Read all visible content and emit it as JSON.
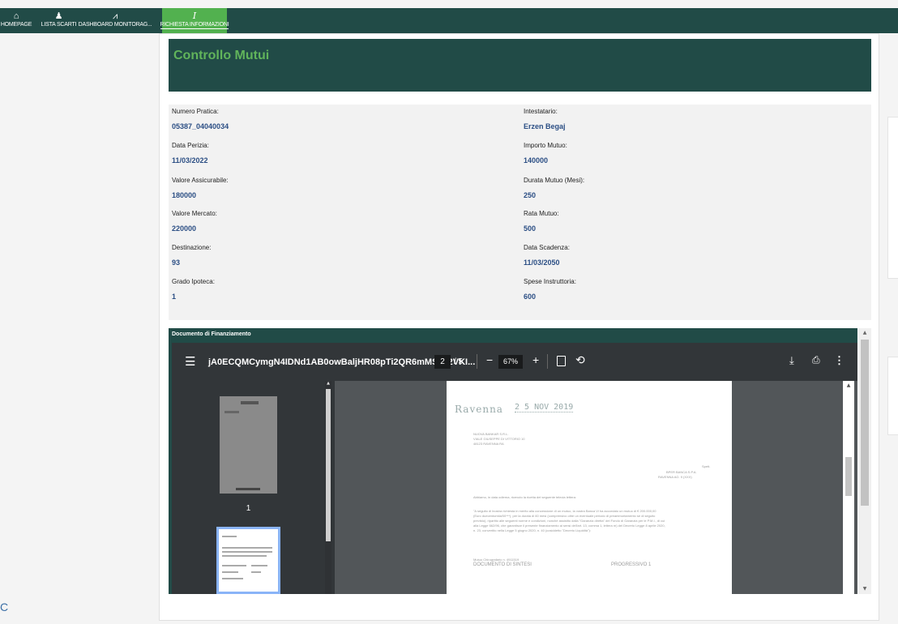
{
  "nav": {
    "items": [
      {
        "label": "HOMEPAGE",
        "icon": "home-icon",
        "glyph": "⌂"
      },
      {
        "label": "LISTA SCARTI",
        "icon": "user-icon",
        "glyph": "♟"
      },
      {
        "label": "DASHBOARD MONITORAG...",
        "icon": "chart-icon",
        "glyph": "⩘"
      },
      {
        "label": "RICHIESTA INFORMAZIONI",
        "icon": "text-cursor-icon",
        "glyph": "I",
        "active": true
      }
    ]
  },
  "page": {
    "title": "Controllo Mutui"
  },
  "fields": {
    "numero_pratica": {
      "label": "Numero Pratica:",
      "value": "05387_04040034"
    },
    "data_perizia": {
      "label": "Data Perizia:",
      "value": "11/03/2022"
    },
    "valore_assicurabile": {
      "label": "Valore Assicurabile:",
      "value": "180000"
    },
    "valore_mercato": {
      "label": "Valore Mercato:",
      "value": "220000"
    },
    "destinazione": {
      "label": "Destinazione:",
      "value": "93"
    },
    "grado_ipoteca": {
      "label": "Grado Ipoteca:",
      "value": "1"
    },
    "intestatario": {
      "label": "Intestatario:",
      "value": "Erzen Begaj"
    },
    "importo_mutuo": {
      "label": "Importo Mutuo:",
      "value": "140000"
    },
    "durata_mutuo": {
      "label": "Durata Mutuo (Mesi):",
      "value": "250"
    },
    "rata_mutuo": {
      "label": "Rata Mutuo:",
      "value": "500"
    },
    "data_scadenza": {
      "label": "Data Scadenza:",
      "value": "11/03/2050"
    },
    "spese_istruttoria": {
      "label": "Spese Instruttoria:",
      "value": "600"
    }
  },
  "document": {
    "section_title": "Documento di Finanziamento",
    "viewer": {
      "file_name": "jA0ECQMCymgN4IDNd1AB0owBaljHR08pTi2QR6mMS2J2VKI...",
      "current_page": "2",
      "total_pages": "/ 5",
      "zoom": "67%",
      "thumbnail_label": "1",
      "page_text": {
        "stamp": "Ravenna",
        "stamp_date": "2 5 NOV 2019",
        "addr1": "NUOVA BANKAR S.R.L.",
        "addr2": "VIALE GIUSEPPE DI VITTORIO 10",
        "addr3": "48123 RAVENNA RA",
        "recv1": "Spett.",
        "recv2": "BPER BANCA S.P.A.",
        "recv3": "RAVENNA AG. 9 (XXX)",
        "intro": "Abbiamo, in data odierna, ricevuto la ricetta del seguente telecia lettera:",
        "body1": "\"A seguito di lnostra richiesta in merito alla concessione di un mutuo, la vostra Banca Vi ha accordato un mutuo di € 200.000,00",
        "body2": "(Euro duecentomila/00***), per la durata di 60 mesi (comprensivo oltre un eventuale periodo di preammortamento se di seguito",
        "body3": "previsto), ripartito alle seguenti norme e condizioni, nonché assistito dalla \"Garanzia diretta\" del Fondo di Garanzia per le P.M.I., di cui",
        "body4": "alla Legge 662/96, che garantisce il presente finanziamento ai sensi dell'art. 13, comma 1, lettera m) del Decreto Legge 8 aprile 2020,",
        "body5": "n. 23, convertito nella Legge 5 giugno 2020, n. 40 (cosiddetto \"Decreto Liquidità\"):",
        "foot1": "Mutuo Chirografario n. 4911519",
        "foot2": "DOCUMENTO DI SINTESI",
        "foot3": "PROGRESSIVO 1"
      }
    }
  },
  "colors": {
    "nav_bg": "#214b47",
    "nav_active": "#52b14f",
    "title_text": "#61b45b",
    "value_text": "#2b4e84"
  },
  "corner_fragment": "C"
}
